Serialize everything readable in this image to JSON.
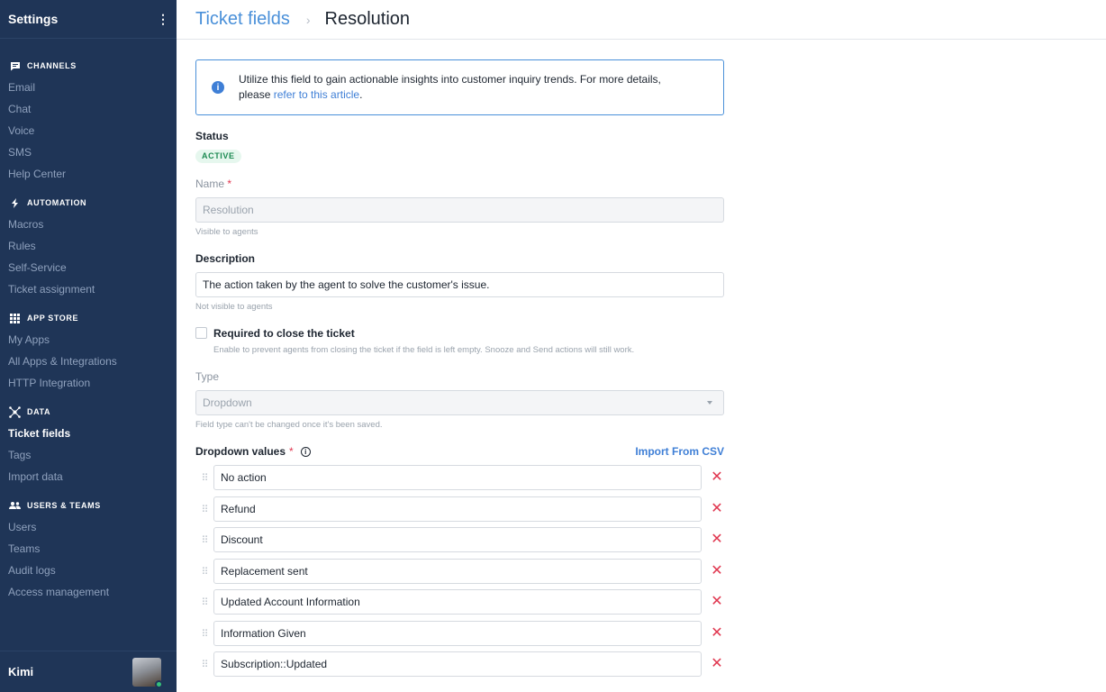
{
  "sidebar": {
    "title": "Settings",
    "menu_glyph": "⋮",
    "sections": {
      "channels": {
        "label": "CHANNELS",
        "icon": "chat-bubble-icon",
        "items": [
          "Email",
          "Chat",
          "Voice",
          "SMS",
          "Help Center"
        ]
      },
      "automation": {
        "label": "AUTOMATION",
        "icon": "lightning-bolt-icon",
        "items": [
          "Macros",
          "Rules",
          "Self-Service",
          "Ticket assignment"
        ]
      },
      "app_store": {
        "label": "APP STORE",
        "icon": "grid-icon",
        "items": [
          "My Apps",
          "All Apps & Integrations",
          "HTTP Integration"
        ]
      },
      "data": {
        "label": "DATA",
        "icon": "network-icon",
        "items": [
          "Ticket fields",
          "Tags",
          "Import data"
        ]
      },
      "users_teams": {
        "label": "USERS & TEAMS",
        "icon": "people-icon",
        "items": [
          "Users",
          "Teams",
          "Audit logs",
          "Access management"
        ]
      }
    },
    "active_item": "Ticket fields",
    "user": {
      "name": "Kimi",
      "online_color": "#35c07a"
    }
  },
  "breadcrumb": {
    "parent": "Ticket fields",
    "separator": "›",
    "current": "Resolution"
  },
  "info_banner": {
    "icon": "i",
    "text": "Utilize this field to gain actionable insights into customer inquiry trends. For more details, please ",
    "link": "refer to this article",
    "suffix": "."
  },
  "status": {
    "label": "Status",
    "value": "ACTIVE"
  },
  "name_field": {
    "label": "Name",
    "required": "*",
    "value": "Resolution",
    "hint": "Visible to agents"
  },
  "description_field": {
    "label": "Description",
    "value": "The action taken by the agent to solve the customer's issue.",
    "hint": "Not visible to agents"
  },
  "required_checkbox": {
    "label": "Required to close the ticket",
    "hint": "Enable to prevent agents from closing the ticket if the field is left empty. Snooze and Send actions will still work.",
    "checked": false
  },
  "type_field": {
    "label": "Type",
    "value": "Dropdown",
    "hint": "Field type can't be changed once it's been saved."
  },
  "dropdown_values": {
    "label": "Dropdown values",
    "required": "*",
    "info_icon": "i",
    "import_label": "Import From CSV",
    "handle_glyph": "⠿",
    "delete_glyph": "✕",
    "items": [
      "No action",
      "Refund",
      "Discount",
      "Replacement sent",
      "Updated Account Information",
      "Information Given",
      "Subscription::Updated"
    ]
  },
  "colors": {
    "sidebar_bg": "#1f3557",
    "accent": "#3f7fd6",
    "danger": "#e0364f",
    "active_badge": "#1c8a52"
  }
}
